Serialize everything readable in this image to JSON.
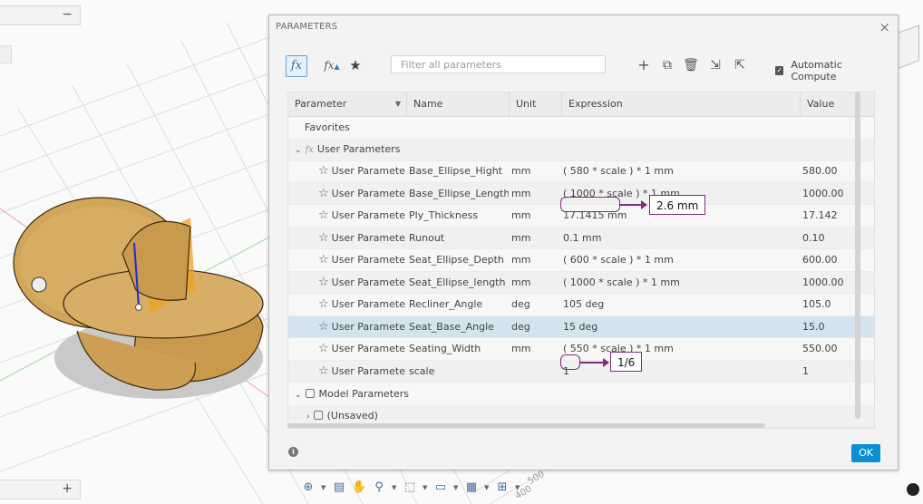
{
  "dialog": {
    "title": "PARAMETERS",
    "close_icon": "close-icon",
    "ok_label": "OK"
  },
  "toolbar": {
    "fx_label": "fx",
    "fx_user_label": "fx",
    "filter_placeholder": "Filter all parameters",
    "auto_compute_label": "Automatic Compute",
    "auto_compute_checked": true
  },
  "table": {
    "headers": {
      "parameter": "Parameter",
      "name": "Name",
      "unit": "Unit",
      "expression": "Expression",
      "value": "Value"
    },
    "groups": {
      "favorites": "Favorites",
      "user": "User Parameters",
      "model": "Model Parameters",
      "unsaved": "(Unsaved)"
    },
    "rows": [
      {
        "type": "User Parameter",
        "name": "Base_Ellipse_Hight",
        "unit": "mm",
        "expression": "( 580 * scale ) * 1 mm",
        "value": "580.00"
      },
      {
        "type": "User Parameter",
        "name": "Base_Ellipse_Length",
        "unit": "mm",
        "expression": "( 1000 * scale ) * 1 mm",
        "value": "1000.00"
      },
      {
        "type": "User Parameter",
        "name": "Ply_Thickness",
        "unit": "mm",
        "expression": "17.1415 mm",
        "value": "17.142"
      },
      {
        "type": "User Parameter",
        "name": "Runout",
        "unit": "mm",
        "expression": "0.1 mm",
        "value": "0.10"
      },
      {
        "type": "User Parameter",
        "name": "Seat_Ellipse_Depth",
        "unit": "mm",
        "expression": "( 600 * scale ) * 1 mm",
        "value": "600.00"
      },
      {
        "type": "User Parameter",
        "name": "Seat_Ellipse_length",
        "unit": "mm",
        "expression": "( 1000 * scale ) * 1 mm",
        "value": "1000.00"
      },
      {
        "type": "User Parameter",
        "name": "Recliner_Angle",
        "unit": "deg",
        "expression": "105 deg",
        "value": "105.0"
      },
      {
        "type": "User Parameter",
        "name": "Seat_Base_Angle",
        "unit": "deg",
        "expression": "15 deg",
        "value": "15.0"
      },
      {
        "type": "User Parameter",
        "name": "Seating_Width",
        "unit": "mm",
        "expression": "( 550 * scale ) * 1 mm",
        "value": "550.00"
      },
      {
        "type": "User Parameter",
        "name": "scale",
        "unit": "",
        "expression": "1",
        "value": "1"
      }
    ]
  },
  "annotations": {
    "ply_thickness_target": "2.6 mm",
    "scale_target": "1/6"
  },
  "viewport": {
    "axis_label_1": "500",
    "axis_label_2": "400"
  },
  "colors": {
    "accent": "#0a8fd4",
    "annotation": "#7b2d7e",
    "selected_row": "#d4e4ef"
  }
}
